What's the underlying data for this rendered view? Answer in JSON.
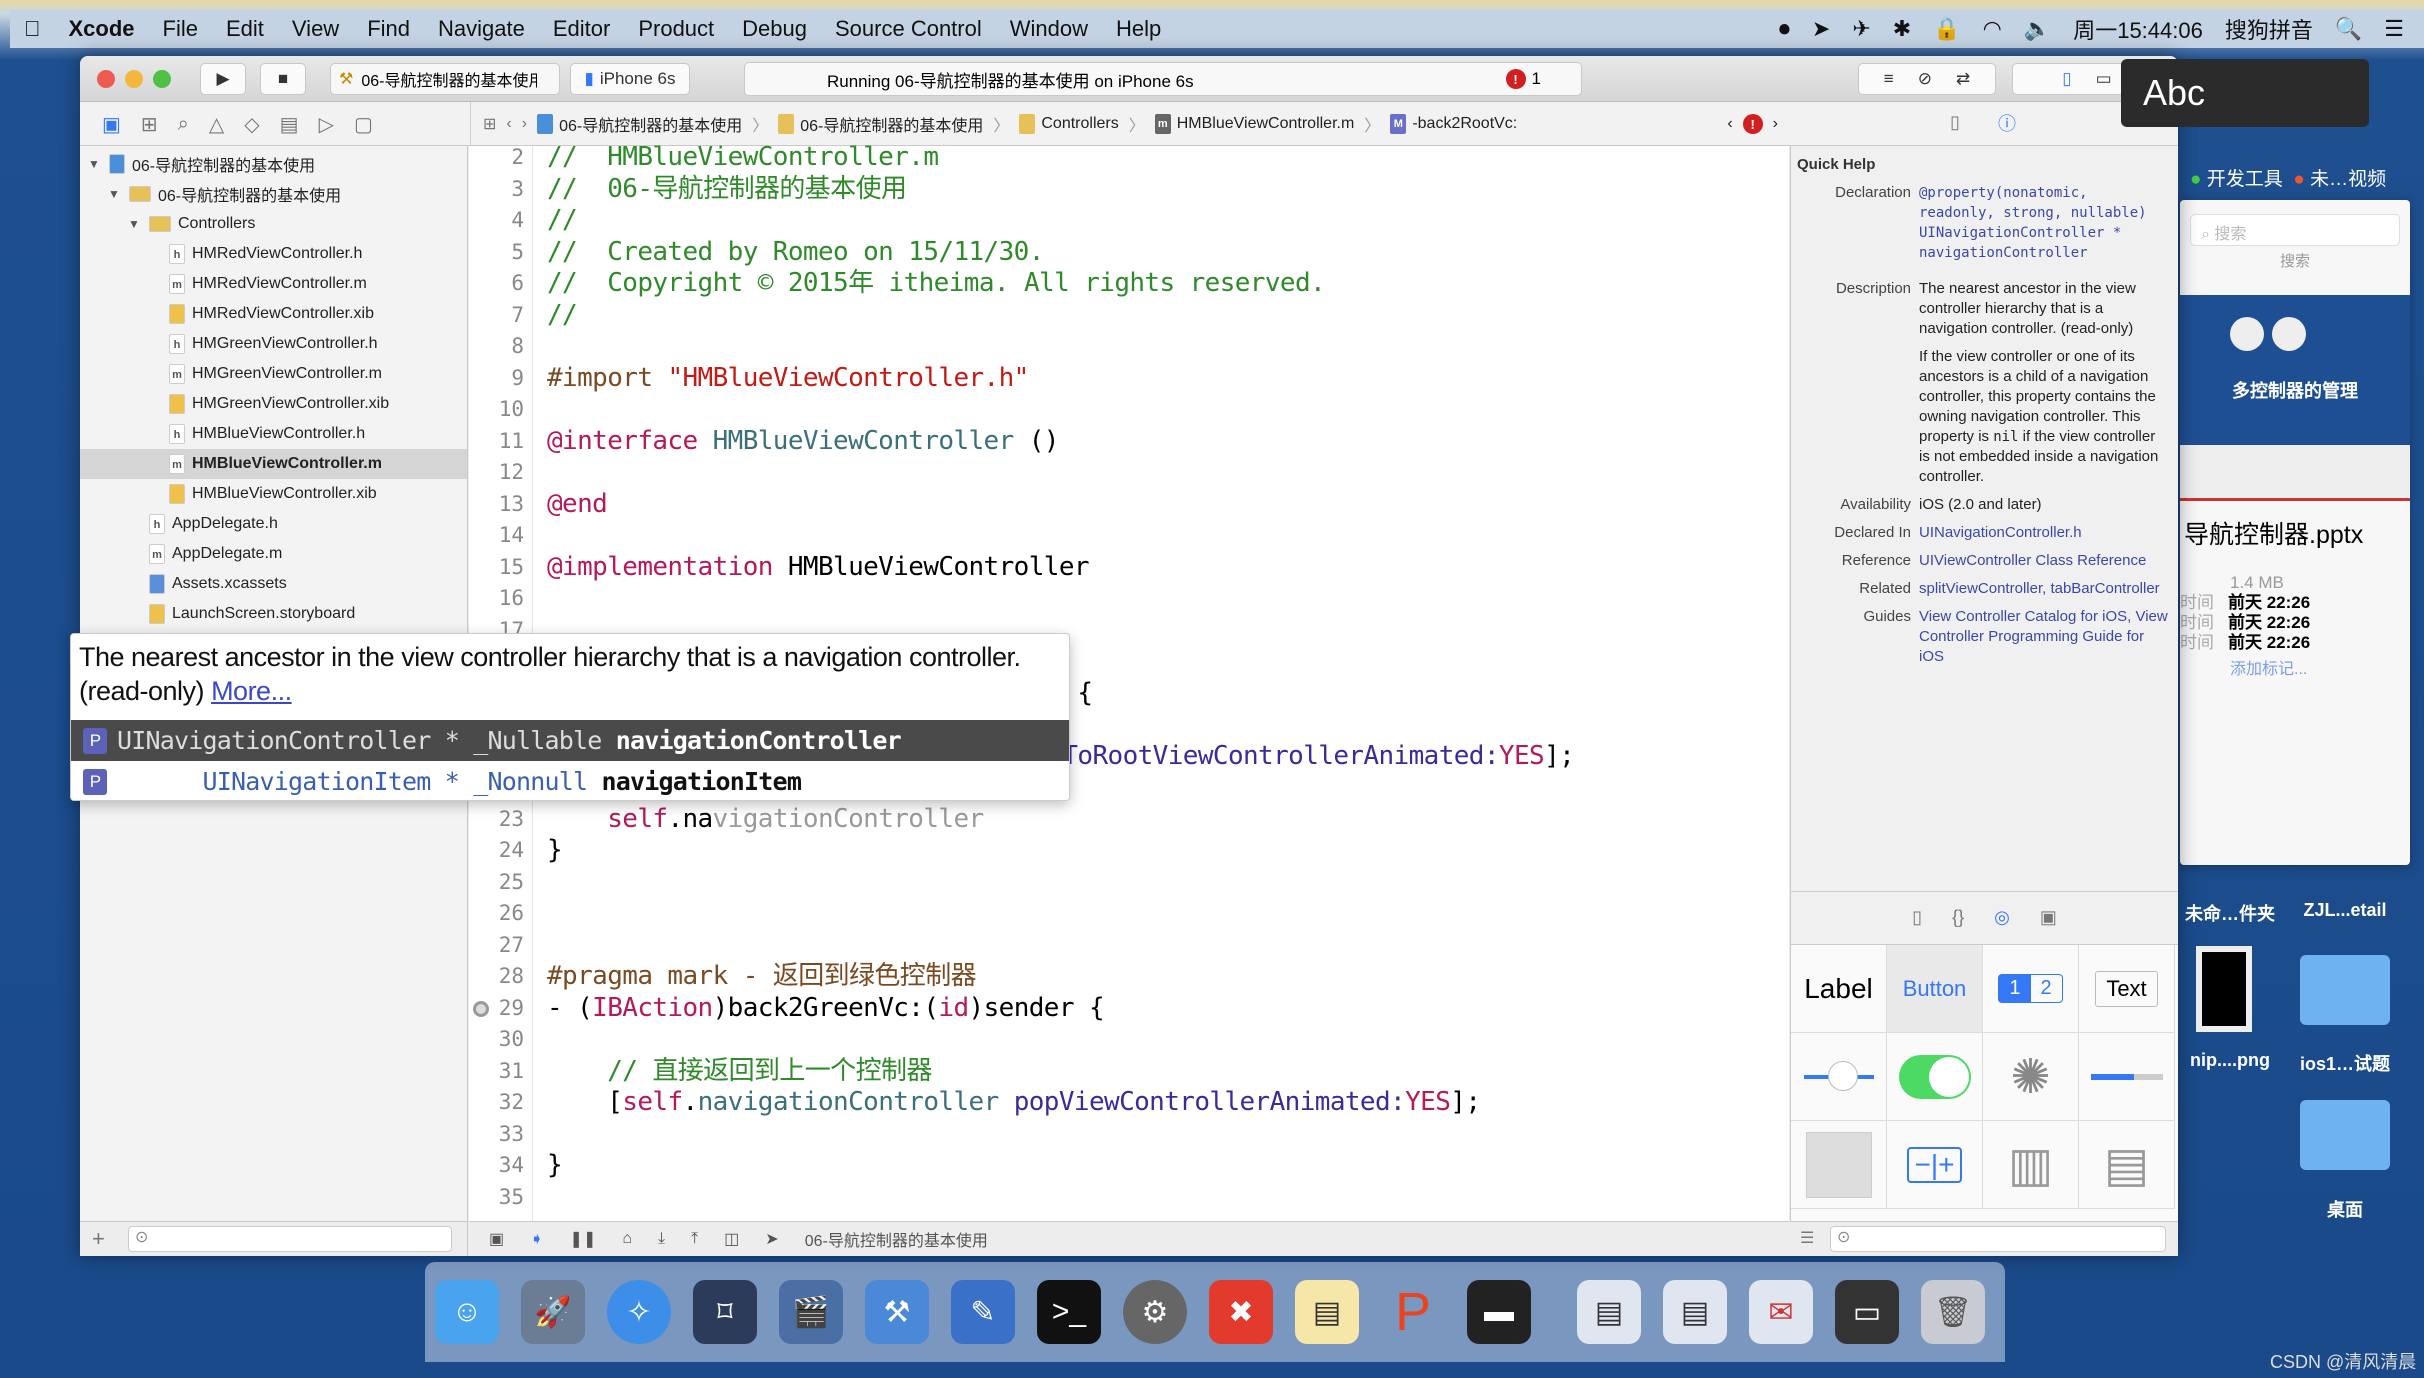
{
  "menubar": {
    "app": "Xcode",
    "items": [
      "File",
      "Edit",
      "View",
      "Find",
      "Navigate",
      "Editor",
      "Product",
      "Debug",
      "Source Control",
      "Window",
      "Help"
    ],
    "clock": "周一15:44:06",
    "input_method": "搜狗拼音"
  },
  "toolbar": {
    "scheme": "06-导航控制器的基本使用",
    "device": "iPhone 6s",
    "activity": "Running 06-导航控制器的基本使用 on iPhone 6s",
    "error_count": "1"
  },
  "jumpbar": {
    "crumbs": [
      "06-导航控制器的基本使用",
      "06-导航控制器的基本使用",
      "Controllers",
      "HMBlueViewController.m",
      "-back2RootVc:"
    ]
  },
  "navigator": {
    "items": [
      {
        "label": "06-导航控制器的基本使用",
        "level": 0,
        "icon": "project",
        "open": true
      },
      {
        "label": "06-导航控制器的基本使用",
        "level": 1,
        "icon": "folder",
        "open": true
      },
      {
        "label": "Controllers",
        "level": 2,
        "icon": "folder",
        "open": true
      },
      {
        "label": "HMRedViewController.h",
        "level": 3,
        "icon": "h"
      },
      {
        "label": "HMRedViewController.m",
        "level": 3,
        "icon": "m"
      },
      {
        "label": "HMRedViewController.xib",
        "level": 3,
        "icon": "xib"
      },
      {
        "label": "HMGreenViewController.h",
        "level": 3,
        "icon": "h"
      },
      {
        "label": "HMGreenViewController.m",
        "level": 3,
        "icon": "m"
      },
      {
        "label": "HMGreenViewController.xib",
        "level": 3,
        "icon": "xib"
      },
      {
        "label": "HMBlueViewController.h",
        "level": 3,
        "icon": "h"
      },
      {
        "label": "HMBlueViewController.m",
        "level": 3,
        "icon": "m",
        "selected": true
      },
      {
        "label": "HMBlueViewController.xib",
        "level": 3,
        "icon": "xib"
      },
      {
        "label": "AppDelegate.h",
        "level": 2,
        "icon": "h"
      },
      {
        "label": "AppDelegate.m",
        "level": 2,
        "icon": "m"
      },
      {
        "label": "Assets.xcassets",
        "level": 2,
        "icon": "xcassets"
      },
      {
        "label": "LaunchScreen.storyboard",
        "level": 2,
        "icon": "storyboard"
      }
    ]
  },
  "colors": {
    "comment": "#2f8a2a",
    "keyword": "#b5195a",
    "string": "#c41a16",
    "class": "#3b6f7a",
    "method": "#3a2b9a",
    "preproc": "#7a4a22",
    "plain": "#000000",
    "ghost": "#9a9a9a",
    "accent": "#3478f6"
  },
  "editor": {
    "lines": [
      {
        "n": "2",
        "tokens": [
          [
            "//  HMBlueViewController.m",
            "comment"
          ]
        ]
      },
      {
        "n": "3",
        "tokens": [
          [
            "//  06-导航控制器的基本使用",
            "comment"
          ]
        ]
      },
      {
        "n": "4",
        "tokens": [
          [
            "//",
            "comment"
          ]
        ]
      },
      {
        "n": "5",
        "tokens": [
          [
            "//  Created by Romeo on 15/11/30.",
            "comment"
          ]
        ]
      },
      {
        "n": "6",
        "tokens": [
          [
            "//  Copyright © 2015年 itheima. All rights reserved.",
            "comment"
          ]
        ]
      },
      {
        "n": "7",
        "tokens": [
          [
            "//",
            "comment"
          ]
        ]
      },
      {
        "n": "8",
        "tokens": []
      },
      {
        "n": "9",
        "tokens": [
          [
            "#import ",
            "preproc"
          ],
          [
            "\"HMBlueViewController.h\"",
            "string"
          ]
        ]
      },
      {
        "n": "10",
        "tokens": []
      },
      {
        "n": "11",
        "tokens": [
          [
            "@interface ",
            "keyword"
          ],
          [
            "HMBlueViewController",
            "class"
          ],
          [
            " ()",
            "plain"
          ]
        ]
      },
      {
        "n": "12",
        "tokens": []
      },
      {
        "n": "13",
        "tokens": [
          [
            "@end",
            "keyword"
          ]
        ]
      },
      {
        "n": "14",
        "tokens": []
      },
      {
        "n": "15",
        "tokens": [
          [
            "@implementation ",
            "keyword"
          ],
          [
            "HMBlueViewController",
            "plain"
          ]
        ]
      },
      {
        "n": "16",
        "tokens": []
      },
      {
        "n": "17",
        "tokens": []
      },
      {
        "n": "",
        "tokens": []
      },
      {
        "n": "",
        "tokens": [
          [
            "er {",
            "plain"
          ]
        ],
        "offset": 31
      },
      {
        "n": "",
        "tokens": []
      },
      {
        "n": "",
        "tokens": [
          [
            "opToRootViewControllerAnimated:",
            "method"
          ],
          [
            "YES",
            "keyword"
          ],
          [
            "];",
            "plain"
          ]
        ],
        "offset": 31
      },
      {
        "n": "",
        "tokens": []
      },
      {
        "n": "23",
        "tokens": [
          [
            "    ",
            "plain"
          ],
          [
            "self",
            "keyword"
          ],
          [
            ".na",
            "plain"
          ],
          [
            "vigationController",
            "ghost"
          ]
        ]
      },
      {
        "n": "24",
        "tokens": [
          [
            "}",
            "plain"
          ]
        ]
      },
      {
        "n": "25",
        "tokens": []
      },
      {
        "n": "26",
        "tokens": []
      },
      {
        "n": "27",
        "tokens": []
      },
      {
        "n": "28",
        "tokens": [
          [
            "#pragma mark - 返回到绿色控制器",
            "preproc"
          ]
        ]
      },
      {
        "n": "29",
        "tokens": [
          [
            "- (",
            "plain"
          ],
          [
            "IBAction",
            "keyword"
          ],
          [
            ")back2GreenVc:(",
            "plain"
          ],
          [
            "id",
            "keyword"
          ],
          [
            ")sender {",
            "plain"
          ]
        ],
        "breakpoint": true
      },
      {
        "n": "30",
        "tokens": []
      },
      {
        "n": "31",
        "tokens": [
          [
            "    // 直接返回到上一个控制器",
            "comment"
          ]
        ]
      },
      {
        "n": "32",
        "tokens": [
          [
            "    [",
            "plain"
          ],
          [
            "self",
            "keyword"
          ],
          [
            ".",
            "plain"
          ],
          [
            "navigationController",
            "class"
          ],
          [
            " popViewControllerAnimated:",
            "method"
          ],
          [
            "YES",
            "keyword"
          ],
          [
            "];",
            "plain"
          ]
        ]
      },
      {
        "n": "33",
        "tokens": []
      },
      {
        "n": "34",
        "tokens": [
          [
            "}",
            "plain"
          ]
        ]
      },
      {
        "n": "35",
        "tokens": []
      }
    ]
  },
  "completion": {
    "description": "The nearest ancestor in the view controller hierarchy that is a navigation controller. (read-only)",
    "more": "More...",
    "items": [
      {
        "badge": "P",
        "type": "UINavigationController * _Nullable ",
        "name": "navigationController",
        "selected": true
      },
      {
        "badge": "P",
        "type": "      UINavigationItem * _Nonnull ",
        "name": "navigationItem"
      }
    ]
  },
  "quick_help": {
    "title": "Quick Help",
    "declaration_label": "Declaration",
    "declaration": "@property(nonatomic, readonly, strong, nullable) UINavigationController * navigationController",
    "description_label": "Description",
    "description": "The nearest ancestor in the view controller hierarchy that is a navigation controller. (read-only)",
    "description2_a": "If the view controller or one of its ancestors is a child of a navigation controller, this property contains the owning navigation controller. This property is ",
    "description2_code": "nil",
    "description2_b": " if the view controller is not embedded inside a navigation controller.",
    "availability_label": "Availability",
    "availability": "iOS (2.0 and later)",
    "declared_label": "Declared In",
    "declared": "UINavigationController.h",
    "reference_label": "Reference",
    "reference": "UIViewController Class Reference",
    "related_label": "Related",
    "related": "splitViewController, tabBarController",
    "guides_label": "Guides",
    "guides": "View Controller Catalog for iOS, View Controller Programming Guide for iOS"
  },
  "library": {
    "label": "Label",
    "button": "Button",
    "seg1": "1",
    "seg2": "2",
    "text": "Text"
  },
  "status_bar": {
    "target": "06-导航控制器的基本使用"
  },
  "overlay": {
    "abc": "Abc"
  },
  "desktop": {
    "tags": [
      "开发工具",
      "未…视频"
    ],
    "preview": {
      "search_placeholder": "搜索",
      "search_label": "搜索",
      "slide_title": "多控制器的管理",
      "filename": "导航控制器.pptx",
      "size": "1.4 MB",
      "dates": [
        [
          "时间",
          "前天 22:26"
        ],
        [
          "时间",
          "前天 22:26"
        ],
        [
          "时间",
          "前天 22:26"
        ]
      ],
      "add_tag": "添加标记..."
    },
    "files": [
      "未命…件夹",
      "ZJL...etail",
      "nip....png",
      "ios1…试题",
      "桌面"
    ]
  },
  "watermark": "CSDN @清风清晨"
}
